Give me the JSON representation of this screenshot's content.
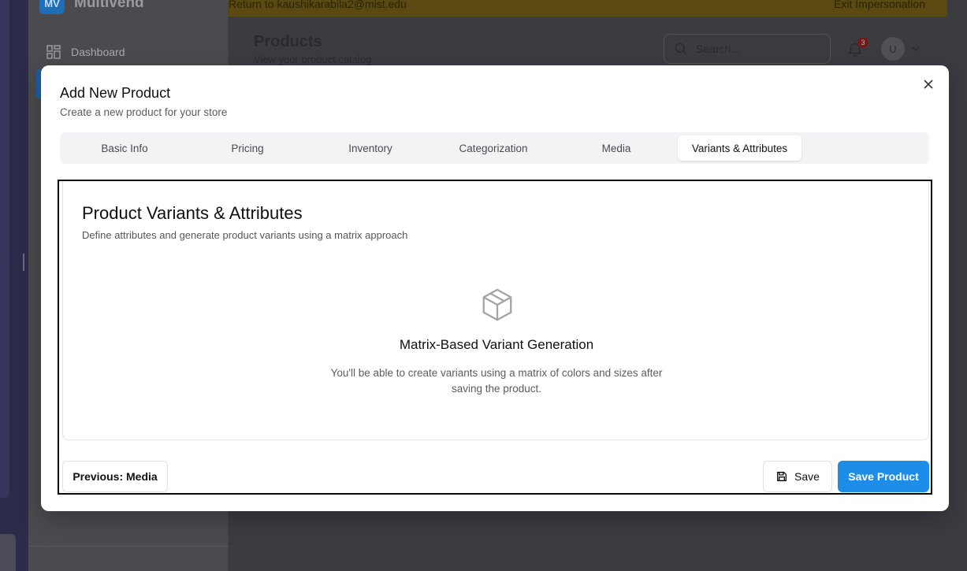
{
  "background": {
    "brand": {
      "logo_text": "MV",
      "name": "Multivend"
    },
    "sidebar": {
      "items": [
        {
          "label": "Dashboard",
          "icon": "dashboard-grid-icon"
        }
      ]
    },
    "impersonation_bar": {
      "text": "Return to kaushikarabila2@mist.edu",
      "exit_label": "Exit Impersonation"
    },
    "header": {
      "title": "Products",
      "subtitle": "View your product catalog",
      "search_placeholder": "Search...",
      "notification_count": "3",
      "avatar_initial": "U"
    }
  },
  "modal": {
    "title": "Add New Product",
    "description": "Create a new product for your store",
    "tabs": [
      {
        "label": "Basic Info",
        "active": false
      },
      {
        "label": "Pricing",
        "active": false
      },
      {
        "label": "Inventory",
        "active": false
      },
      {
        "label": "Categorization",
        "active": false
      },
      {
        "label": "Media",
        "active": false
      },
      {
        "label": "Variants & Attributes",
        "active": true
      }
    ],
    "section": {
      "title": "Product Variants & Attributes",
      "description": "Define attributes and generate product variants using a matrix approach",
      "empty_icon": "package-box-icon",
      "empty_title": "Matrix-Based Variant Generation",
      "empty_description": "You'll be able to create variants using a matrix of colors and sizes after saving the product."
    },
    "footer": {
      "previous_label": "Previous: Media",
      "save_label": "Save",
      "save_product_label": "Save Product"
    }
  },
  "colors": {
    "primary": "#1e8de8",
    "modal_bg": "#ffffff",
    "overlay": "#3b3b42"
  }
}
